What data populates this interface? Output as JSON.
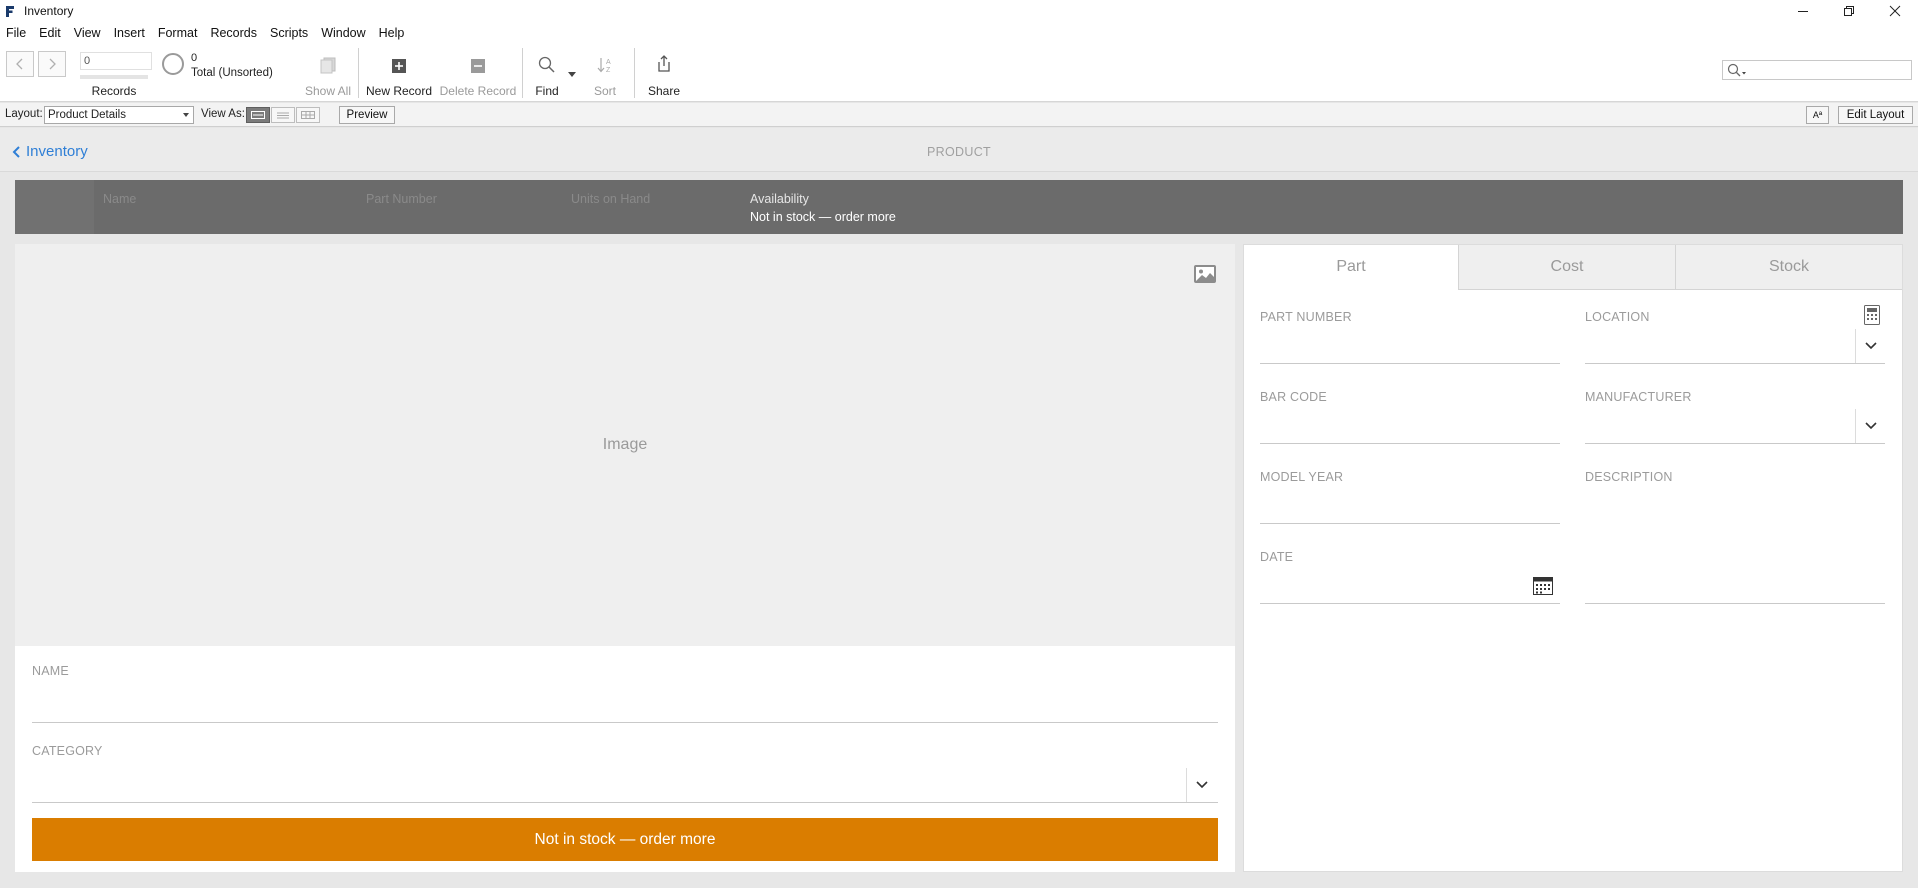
{
  "window": {
    "title": "Inventory",
    "controls": [
      "minimize-icon",
      "restore-icon",
      "close-icon"
    ]
  },
  "menu": [
    "File",
    "Edit",
    "View",
    "Insert",
    "Format",
    "Records",
    "Scripts",
    "Window",
    "Help"
  ],
  "toolbar": {
    "record_value": "0",
    "records_label": "Records",
    "found_count": "0",
    "total_label": "Total (Unsorted)",
    "show_all": "Show All",
    "new_record": "New Record",
    "delete_record": "Delete Record",
    "find": "Find",
    "sort": "Sort",
    "share": "Share",
    "search_value": ""
  },
  "layoutbar": {
    "layout_label": "Layout:",
    "layout_value": "Product Details",
    "view_as_label": "View As:",
    "preview": "Preview",
    "font_toggle": "Aª",
    "edit_layout": "Edit Layout"
  },
  "header": {
    "back_label": "Inventory",
    "title": "PRODUCT"
  },
  "list_header": {
    "name": "Name",
    "part_number": "Part Number",
    "units_on_hand": "Units on Hand",
    "availability": "Availability",
    "availability_value": "Not in stock — order more"
  },
  "left": {
    "image_label": "Image",
    "name_label": "NAME",
    "name_value": "",
    "category_label": "CATEGORY",
    "category_value": "",
    "status_button": "Not in stock — order more",
    "status_color": "#da7d00"
  },
  "tabs": [
    "Part",
    "Cost",
    "Stock"
  ],
  "active_tab": "Part",
  "part": {
    "part_number_label": "PART NUMBER",
    "location_label": "LOCATION",
    "bar_code_label": "BAR CODE",
    "manufacturer_label": "MANUFACTURER",
    "model_year_label": "MODEL YEAR",
    "description_label": "DESCRIPTION",
    "date_label": "DATE"
  },
  "colors": {
    "accent_link": "#2f7fd6",
    "list_band": "#6b6b6b",
    "status_orange": "#da7d00"
  }
}
